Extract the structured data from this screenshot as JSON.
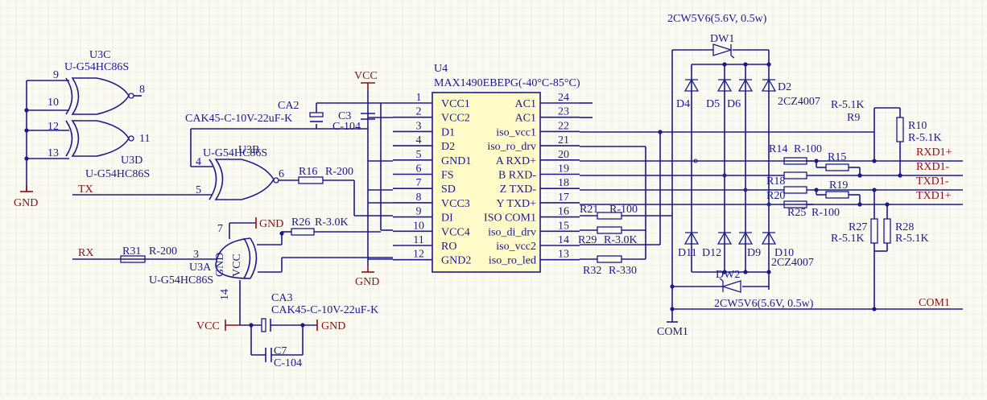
{
  "u4": {
    "ref": "U4",
    "part": "MAX1490EBEPG(-40°C-85°C)",
    "left_pins": [
      {
        "num": "1",
        "name": "VCC1"
      },
      {
        "num": "2",
        "name": "VCC2"
      },
      {
        "num": "3",
        "name": "D1"
      },
      {
        "num": "4",
        "name": "D2"
      },
      {
        "num": "5",
        "name": "GND1"
      },
      {
        "num": "6",
        "name": "FS"
      },
      {
        "num": "7",
        "name": "SD"
      },
      {
        "num": "8",
        "name": "VCC3"
      },
      {
        "num": "9",
        "name": "DI"
      },
      {
        "num": "10",
        "name": "VCC4"
      },
      {
        "num": "11",
        "name": "RO"
      },
      {
        "num": "12",
        "name": "GND2"
      }
    ],
    "right_pins": [
      {
        "num": "24",
        "name": "AC1"
      },
      {
        "num": "23",
        "name": "AC1"
      },
      {
        "num": "22",
        "name": "iso_vcc1"
      },
      {
        "num": "21",
        "name": "iso_ro_drv"
      },
      {
        "num": "20",
        "name": "A RXD+"
      },
      {
        "num": "19",
        "name": "B RXD-"
      },
      {
        "num": "18",
        "name": "Z TXD-"
      },
      {
        "num": "17",
        "name": "Y TXD+"
      },
      {
        "num": "16",
        "name": "ISO COM1"
      },
      {
        "num": "15",
        "name": "iso_di_drv"
      },
      {
        "num": "14",
        "name": "iso_vcc2"
      },
      {
        "num": "13",
        "name": "iso_ro_led"
      }
    ]
  },
  "gates": {
    "u3c": {
      "ref": "U3C",
      "part": "U-G54HC86S",
      "pins": [
        "9",
        "10",
        "8"
      ]
    },
    "u3d": {
      "ref": "U3D",
      "part": "U-G54HC86S",
      "pins": [
        "12",
        "13",
        "11"
      ]
    },
    "u3b": {
      "ref": "U3B",
      "part": "U-G54HC86S",
      "pins": [
        "4",
        "5",
        "6"
      ]
    },
    "u3a": {
      "ref": "U3A",
      "part": "U-G54HC86S",
      "pins": [
        "3",
        "7",
        "14"
      ],
      "gnd": "GND",
      "vcc": "VCC"
    }
  },
  "caps": {
    "ca2": {
      "ref": "CA2",
      "part": "CAK45-C-10V-22uF-K"
    },
    "c3": {
      "ref": "C3",
      "part": "C-104"
    },
    "ca3": {
      "ref": "CA3",
      "part": "CAK45-C-10V-22uF-K"
    },
    "c7": {
      "ref": "C7",
      "part": "C-104"
    }
  },
  "resistors": {
    "r16": {
      "ref": "R16",
      "part": "R-200"
    },
    "r26": {
      "ref": "R26",
      "part": "R-3.0K"
    },
    "r31": {
      "ref": "R31",
      "part": "R-200"
    },
    "r21": {
      "ref": "R21",
      "part": "R-100"
    },
    "r29": {
      "ref": "R29",
      "part": "R-3.0K"
    },
    "r32": {
      "ref": "R32",
      "part": "R-330"
    },
    "r14": {
      "ref": "R14",
      "part": "R-100"
    },
    "r15": {
      "ref": "R15"
    },
    "r18": {
      "ref": "R18"
    },
    "r19": {
      "ref": "R19"
    },
    "r20": {
      "ref": "R20"
    },
    "r25": {
      "ref": "R25",
      "part": "R-100"
    },
    "r9": {
      "ref": "R9",
      "part": "R-5.1K"
    },
    "r10": {
      "ref": "R10",
      "part": "R-5.1K"
    },
    "r27": {
      "ref": "R27",
      "part": "R-5.1K"
    },
    "r28": {
      "ref": "R28",
      "part": "R-5.1K"
    }
  },
  "diodes": {
    "dw1": {
      "ref": "DW1",
      "part": "2CW5V6(5.6V, 0.5w)"
    },
    "dw2": {
      "ref": "DW2",
      "part": "2CW5V6(5.6V, 0.5w)"
    },
    "d2": {
      "ref": "D2",
      "part": "2CZ4007"
    },
    "d10": {
      "ref": "D10",
      "part": "2CZ4007"
    },
    "d4": {
      "ref": "D4"
    },
    "d5": {
      "ref": "D5"
    },
    "d6": {
      "ref": "D6"
    },
    "d11": {
      "ref": "D11"
    },
    "d12": {
      "ref": "D12"
    },
    "d9": {
      "ref": "D9"
    }
  },
  "power": {
    "vcc_top": "VCC",
    "gnd_bottom": "GND",
    "gnd_left": "GND",
    "gnd_u3a": "GND",
    "vcc_ca3": "VCC",
    "gnd_ca3": "GND",
    "com1_bottom": "COM1"
  },
  "nets": {
    "tx": "TX",
    "rx": "RX",
    "rxd_plus": "RXD1+",
    "rxd_minus": "RXD1-",
    "txd_minus": "TXD1-",
    "txd_plus": "TXD1+",
    "com1": "COM1"
  },
  "colors": {
    "wire": "#1a1a8c",
    "power": "#8b1010",
    "background": "#fbfbf3"
  }
}
